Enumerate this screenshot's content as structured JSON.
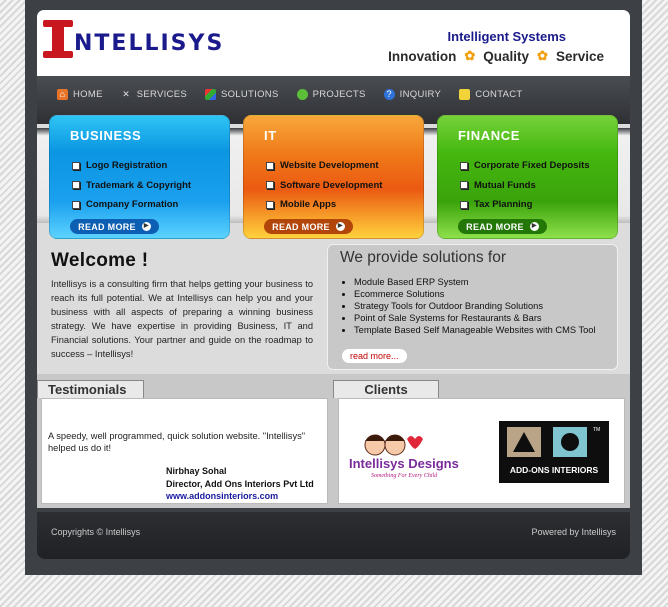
{
  "header": {
    "logo_text": "NTELLISYS",
    "tagline_title": "Intelligent Systems",
    "values": [
      "Innovation",
      "Quality",
      "Service"
    ]
  },
  "nav": {
    "items": [
      {
        "label": "HOME",
        "icon": "home-icon"
      },
      {
        "label": "SERVICES",
        "icon": "tools-icon"
      },
      {
        "label": "SOLUTIONS",
        "icon": "cubes-icon"
      },
      {
        "label": "PROJECTS",
        "icon": "globe-icon"
      },
      {
        "label": "INQUIRY",
        "icon": "question-icon"
      },
      {
        "label": "CONTACT",
        "icon": "contact-icon"
      }
    ]
  },
  "boxes": [
    {
      "title": "BUSINESS",
      "items": [
        "Logo Registration",
        "Trademark & Copyright",
        "Company Formation"
      ],
      "more": "READ MORE",
      "color": "#0b95e2"
    },
    {
      "title": "IT",
      "items": [
        "Website Development",
        "Software Development",
        "Mobile Apps"
      ],
      "more": "READ MORE",
      "color": "#f07b1a"
    },
    {
      "title": "FINANCE",
      "items": [
        "Corporate Fixed Deposits",
        "Mutual Funds",
        "Tax Planning"
      ],
      "more": "READ MORE",
      "color": "#45b80f"
    }
  ],
  "welcome": {
    "title": "Welcome !",
    "text": "Intellisys is a consulting firm that helps getting your business to reach its full potential. We at Intellisys can help you and your business with all aspects of preparing a winning business strategy. We have expertise in providing Business, IT and Financial solutions. Your partner and guide on the roadmap to success – Intellisys!"
  },
  "solutions": {
    "title": "We provide solutions for",
    "items": [
      "Module Based ERP System",
      "Ecommerce Solutions",
      "Strategy Tools for Outdoor Branding Solutions",
      "Point of Sale Systems for Restaurants & Bars",
      "Template Based Self Manageable Websites with CMS Tool"
    ],
    "read_more": "read more..."
  },
  "testimonials": {
    "tab": "Testimonials",
    "quote": "A speedy, well programmed, quick solution website. \"Intellisys\" helped us do it!",
    "name": "Nirbhay Sohal",
    "role": "Director, Add Ons Interiors Pvt Ltd",
    "link": "www.addonsinteriors.com"
  },
  "clients": {
    "tab": "Clients",
    "client1": {
      "name": "Intellisys Designs",
      "tagline": "Something For Every Child"
    },
    "client2": {
      "name": "ADD-ONS INTERIORS"
    }
  },
  "footer": {
    "copyright": "Copyrights © Intellisys",
    "powered": "Powered by Intellisys"
  }
}
